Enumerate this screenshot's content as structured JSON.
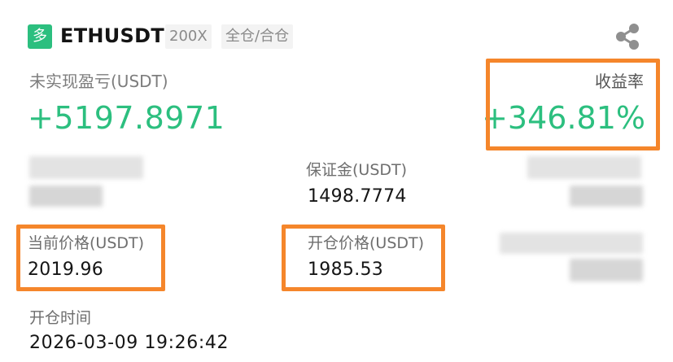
{
  "header": {
    "side_badge": "多",
    "symbol": "ETHUSDT",
    "leverage": "200X",
    "margin_mode": "全仓/合仓",
    "share_icon": "share-icon"
  },
  "pnl": {
    "label": "未实现盈亏(USDT)",
    "value": "+5197.8971"
  },
  "roi": {
    "label": "收益率",
    "value": "+346.81%"
  },
  "margin": {
    "label": "保证金(USDT)",
    "value": "1498.7774"
  },
  "current_price": {
    "label": "当前价格(USDT)",
    "value": "2019.96"
  },
  "open_price": {
    "label": "开仓价格(USDT)",
    "value": "1985.53"
  },
  "open_time": {
    "label": "开仓时间",
    "value": "2026-03-09 19:26:42"
  },
  "colors": {
    "profit_green": "#2cbf7f",
    "highlight_orange": "#f5862b",
    "chip_bg": "#f3f3f3"
  }
}
